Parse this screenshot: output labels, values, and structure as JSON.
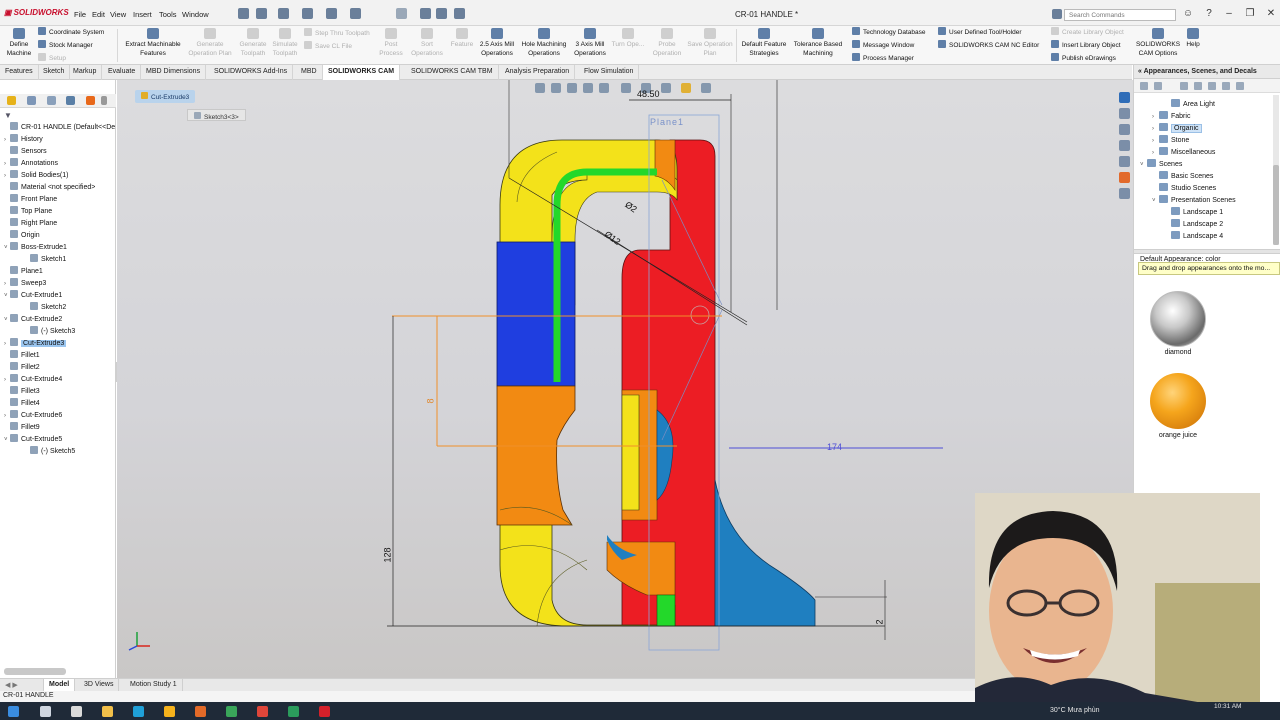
{
  "app": {
    "logo": "SOLIDWORKS",
    "document_title": "CR-01 HANDLE *",
    "menus": [
      "File",
      "Edit",
      "View",
      "Insert",
      "Tools",
      "Window"
    ],
    "search_placeholder": "Search Commands"
  },
  "command_manager": {
    "define_machine": "Define Machine",
    "coordinate_system": "Coordinate System",
    "stock_manager": "Stock Manager",
    "setup": "Setup",
    "extract_machinable_features": "Extract Machinable Features",
    "generate_operation_plan": "Generate Operation Plan",
    "generate_toolpath": "Generate Toolpath",
    "simulate_toolpath": "Simulate Toolpath",
    "step_thru_toolpath": "Step Thru Toolpath",
    "save_cl_file": "Save CL File",
    "post_process": "Post Process",
    "sort_operations": "Sort Operations",
    "feature": "Feature",
    "axis25_mill": "2.5 Axis Mill Operations",
    "hole_machining": "Hole Machining Operations",
    "axis3_mill": "3 Axis Mill Operations",
    "turn_ope": "Turn Ope...",
    "probe_operation": "Probe Operation",
    "save_operation_plan": "Save Operation Plan",
    "default_feature_strategies": "Default Feature Strategies",
    "tolerance_based_machining": "Tolerance Based Machining",
    "technology_database": "Technology Database",
    "message_window": "Message Window",
    "process_manager": "Process Manager",
    "user_defined_tool": "User Defined Tool/Holder",
    "cam_nc_editor": "SOLIDWORKS CAM NC Editor",
    "create_library_object": "Create Library Object",
    "insert_library_object": "Insert Library Object",
    "publish_edrawings": "Publish eDrawings",
    "cam_options": "SOLIDWORKS CAM Options",
    "help": "Help"
  },
  "tabs": [
    "Features",
    "Sketch",
    "Markup",
    "Evaluate",
    "MBD Dimensions",
    "SOLIDWORKS Add-Ins",
    "MBD",
    "SOLIDWORKS CAM",
    "SOLIDWORKS CAM TBM",
    "Analysis Preparation",
    "Flow Simulation"
  ],
  "feature_tree": [
    {
      "label": "CR-01 HANDLE  (Default<<De",
      "exp": ""
    },
    {
      "label": "History",
      "exp": "›"
    },
    {
      "label": "Sensors",
      "exp": ""
    },
    {
      "label": "Annotations",
      "exp": "›"
    },
    {
      "label": "Solid Bodies(1)",
      "exp": "›"
    },
    {
      "label": "Material <not specified>",
      "exp": ""
    },
    {
      "label": "Front Plane",
      "exp": ""
    },
    {
      "label": "Top Plane",
      "exp": ""
    },
    {
      "label": "Right Plane",
      "exp": ""
    },
    {
      "label": "Origin",
      "exp": ""
    },
    {
      "label": "Boss-Extrude1",
      "exp": "˅"
    },
    {
      "label": "Sketch1",
      "exp": ""
    },
    {
      "label": "Plane1",
      "exp": ""
    },
    {
      "label": "Sweep3",
      "exp": "›"
    },
    {
      "label": "Cut-Extrude1",
      "exp": "˅"
    },
    {
      "label": "Sketch2",
      "exp": ""
    },
    {
      "label": "Cut-Extrude2",
      "exp": "˅"
    },
    {
      "label": "(-) Sketch3",
      "exp": ""
    },
    {
      "label": "Cut-Extrude3",
      "exp": "›"
    },
    {
      "label": "Fillet1",
      "exp": ""
    },
    {
      "label": "Fillet2",
      "exp": ""
    },
    {
      "label": "Cut-Extrude4",
      "exp": "›"
    },
    {
      "label": "Fillet3",
      "exp": ""
    },
    {
      "label": "Fillet4",
      "exp": ""
    },
    {
      "label": "Cut-Extrude6",
      "exp": "›"
    },
    {
      "label": "Fillet9",
      "exp": ""
    },
    {
      "label": "Cut-Extrude5",
      "exp": "˅"
    },
    {
      "label": "(-) Sketch5",
      "exp": ""
    }
  ],
  "viewport": {
    "breadcrumb_feature": "Cut-Extrude3",
    "breadcrumb_sketch": "Sketch3<3>",
    "dim_top": "48.50",
    "plane_label": "Plane1",
    "dim_d1": "Ø2",
    "dim_d2": "Ø12",
    "dim_174": "174",
    "dim_128": "128",
    "dim_2": "2",
    "dim_left": "8"
  },
  "task_pane": {
    "title": "Appearances, Scenes, and Decals",
    "items": [
      {
        "label": "Area Light",
        "exp": ""
      },
      {
        "label": "Fabric",
        "exp": "›"
      },
      {
        "label": "Organic",
        "exp": "›"
      },
      {
        "label": "Stone",
        "exp": "›"
      },
      {
        "label": "Miscellaneous",
        "exp": "›"
      },
      {
        "label": "Scenes",
        "exp": "˅"
      },
      {
        "label": "Basic Scenes",
        "exp": ""
      },
      {
        "label": "Studio Scenes",
        "exp": ""
      },
      {
        "label": "Presentation Scenes",
        "exp": "˅"
      },
      {
        "label": "Landscape 1",
        "exp": ""
      },
      {
        "label": "Landscape 2",
        "exp": ""
      },
      {
        "label": "Landscape 4",
        "exp": ""
      }
    ],
    "default_appearance": "Default Appearance: color",
    "tooltip": "Drag and drop appearances onto the mo...",
    "thumbs": [
      {
        "label": "diamond"
      },
      {
        "label": "orange juice"
      }
    ]
  },
  "bottom_tabs": [
    "Model",
    "3D Views",
    "Motion Study 1"
  ],
  "status_text": "CR-01 HANDLE",
  "taskbar": {
    "weather": "30°C  Mưa phùn",
    "clock": "10:31 AM"
  },
  "colors": {
    "part_yellow": "#f3e21a",
    "part_blue": "#1f3ee0",
    "part_red": "#ec1d24",
    "part_orange": "#f28a12",
    "part_green": "#23d82a",
    "part_teal": "#1f7fc0",
    "accent_selection": "#9bc6f0"
  }
}
